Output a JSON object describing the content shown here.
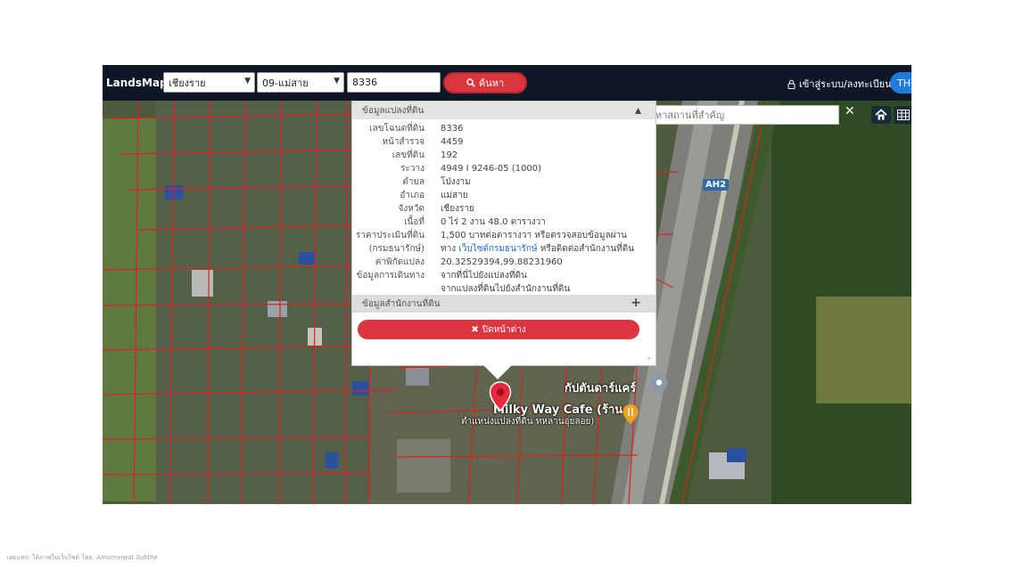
{
  "navbar": {
    "brand": "LandsMaps",
    "province_select": "เชียงราย",
    "district_select": "09-แม่สาย",
    "parcel_input": "8336",
    "search_button": "ค้นหา",
    "login_text": "เข้าสู่ระบบ/ลงทะเบียน",
    "language": "TH"
  },
  "map": {
    "place_search_placeholder": "ค้นหาสถานที่สำคัญ",
    "road_badge": "AH2",
    "place_label_1": "กัปตันดาร์แคร์",
    "place_label_2": "Milky Way Cafe (ร้าน",
    "place_label_3": "ตำแหน่งแปลงที่ดิน ทหลานอุ่ยลอย)"
  },
  "popup": {
    "title": "ข้อมูลแปลงที่ดิน",
    "rows": [
      {
        "label": "เลขโฉนดที่ดิน",
        "value": "8336"
      },
      {
        "label": "หน้าสำรวจ",
        "value": "4459"
      },
      {
        "label": "เลขที่ดิน",
        "value": "192"
      },
      {
        "label": "ระวาง",
        "value": "4949 I 9246-05 (1000)"
      },
      {
        "label": "ตำบล",
        "value": "โป่งงาม"
      },
      {
        "label": "อำเภอ",
        "value": "แม่สาย"
      },
      {
        "label": "จังหวัด",
        "value": "เชียงราย"
      },
      {
        "label": "เนื้อที่",
        "value": "0 ไร่ 2 งาน 48.0 ตารางวา"
      },
      {
        "label": "ราคาประเมินที่ดิน",
        "value": "1,500 บาทต่อตารางวา หรือตรวจสอบข้อมูลผ่าน"
      },
      {
        "label": "(กรมธนารักษ์)",
        "value_prefix": "ทาง ",
        "value_link": "เว็บไซต์กรมธนารักษ์",
        "value_suffix": " หรือติดต่อสำนักงานที่ดิน"
      },
      {
        "label": "ค่าพิกัดแปลง",
        "value": "20.32529394,99.88231960"
      },
      {
        "label": "ข้อมูลการเดินทาง",
        "value": "จากที่นี่ไปยังแปลงที่ดิน"
      },
      {
        "label": "",
        "value": "จากแปลงที่ดินไปยังสำนักงานที่ดิน"
      }
    ],
    "section2_title": "ข้อมูลสำนักงานที่ดิน",
    "close_button": "ปิดหน้าต่าง"
  },
  "caption": "เผยแพร่: ได้ภาพในเว็บไซต์ โดย: Amornviwat Sukthe",
  "colors": {
    "navbar": "#0e1726",
    "accent": "#d9363e",
    "link": "#1e6fd0",
    "parcel_lines": "#e02020"
  }
}
